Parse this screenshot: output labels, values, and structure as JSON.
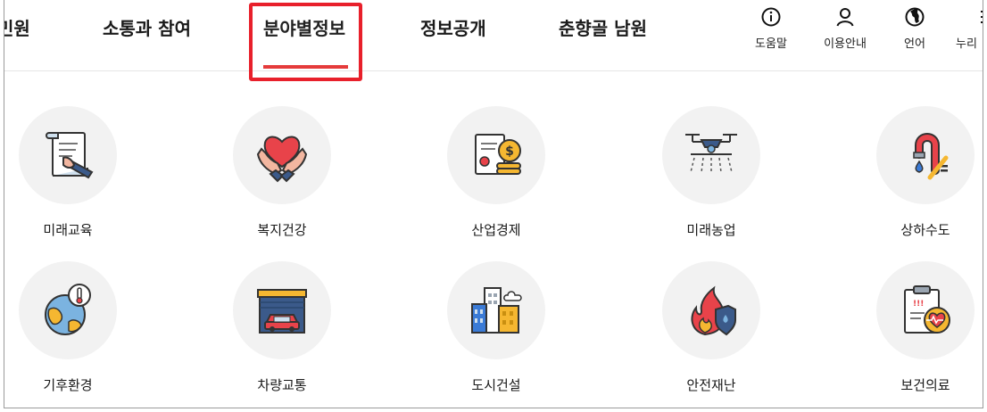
{
  "nav": {
    "items": [
      {
        "label": "민원"
      },
      {
        "label": "소통과 참여"
      },
      {
        "label": "분야별정보"
      },
      {
        "label": "정보공개"
      },
      {
        "label": "춘향골 남원"
      }
    ],
    "active_index": 2,
    "highlight_color": "#e8202b",
    "underline_color": "#e53b3b"
  },
  "utilities": [
    {
      "label": "도움말",
      "icon": "info-icon"
    },
    {
      "label": "이용안내",
      "icon": "user-icon"
    },
    {
      "label": "언어",
      "icon": "globe-icon"
    },
    {
      "label": "누리",
      "icon": "menu-icon"
    }
  ],
  "categories": [
    {
      "label": "미래교육",
      "icon": "scroll-pen-icon"
    },
    {
      "label": "복지건강",
      "icon": "heart-hands-icon"
    },
    {
      "label": "산업경제",
      "icon": "certificate-coins-icon"
    },
    {
      "label": "미래농업",
      "icon": "drone-icon"
    },
    {
      "label": "상하수도",
      "icon": "faucet-icon"
    },
    {
      "label": "기후환경",
      "icon": "earth-thermometer-icon"
    },
    {
      "label": "차량교통",
      "icon": "garage-car-icon"
    },
    {
      "label": "도시건설",
      "icon": "buildings-icon"
    },
    {
      "label": "안전재난",
      "icon": "fire-shield-icon"
    },
    {
      "label": "보건의료",
      "icon": "clipboard-heart-icon"
    }
  ]
}
